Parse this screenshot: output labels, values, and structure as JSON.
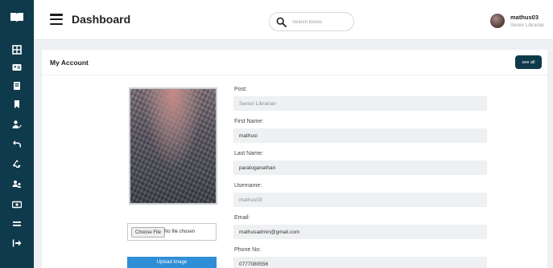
{
  "header": {
    "title": "Dashboard",
    "search_placeholder": "Search Books",
    "user": {
      "name": "mathus03",
      "role": "Senior Librarian"
    }
  },
  "sidebar": {
    "logo_icon": "book-open-icon",
    "items": [
      {
        "icon": "grid-icon"
      },
      {
        "icon": "id-card-icon"
      },
      {
        "icon": "book-icon"
      },
      {
        "icon": "bookmark-icon"
      },
      {
        "icon": "user-edit-icon"
      },
      {
        "icon": "return-icon"
      },
      {
        "icon": "recycle-icon"
      },
      {
        "icon": "users-icon"
      },
      {
        "icon": "money-icon"
      },
      {
        "icon": "menu-lines-icon"
      },
      {
        "icon": "logout-icon"
      }
    ]
  },
  "account": {
    "title": "My Account",
    "see_all": "see all",
    "choose_file": "Choose File",
    "no_file": "No file chosen",
    "upload_label": "Upload Image",
    "fields": [
      {
        "label": "Post:",
        "value": "Senior Librarian"
      },
      {
        "label": "First Name:",
        "value": "mathusi"
      },
      {
        "label": "Last Name:",
        "value": "paraloganathan"
      },
      {
        "label": "Username:",
        "value": "mathus03"
      },
      {
        "label": "Email:",
        "value": "mathusadmin@gmail.com"
      },
      {
        "label": "Phone No:",
        "value": "0777080556"
      }
    ]
  },
  "colors": {
    "sidebar": "#0f3a4c",
    "accent": "#2f8ed6",
    "field_bg": "#eef0f2"
  }
}
